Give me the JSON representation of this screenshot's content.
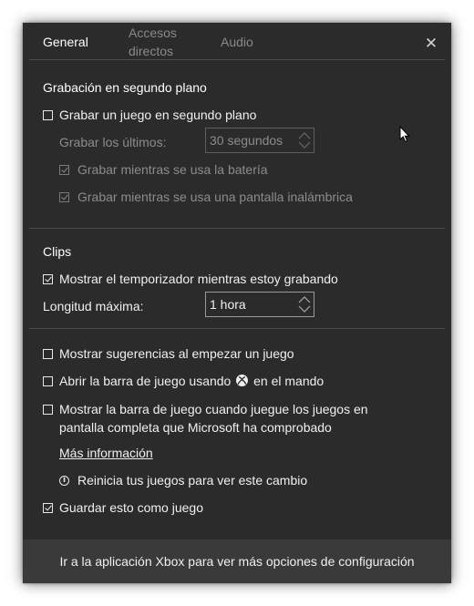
{
  "tabs": {
    "general": "General",
    "accesos_line1": "Accesos",
    "accesos_line2": "directos",
    "audio": "Audio"
  },
  "close_glyph": "✕",
  "background_recording": {
    "title": "Grabación en segundo plano",
    "record_game": {
      "label": "Grabar un juego en segundo plano",
      "checked": false
    },
    "record_last": {
      "label": "Grabar los últimos:",
      "value": "30 segundos"
    },
    "record_battery": {
      "label": "Grabar mientras se usa la batería",
      "checked": true
    },
    "record_wireless": {
      "label": "Grabar mientras se usa una pantalla inalámbrica",
      "checked": true
    }
  },
  "clips": {
    "title": "Clips",
    "show_timer": {
      "label": "Mostrar el temporizador mientras estoy grabando",
      "checked": true
    },
    "max_length": {
      "label": "Longitud máxima:",
      "value": "1 hora"
    }
  },
  "options": {
    "show_tips": {
      "label": "Mostrar sugerencias al empezar un juego",
      "checked": false
    },
    "open_bar_prefix": "Abrir la barra de juego usando",
    "open_bar_suffix": "en el mando",
    "open_bar_checked": false,
    "show_bar_line1": "Mostrar la barra de juego cuando juegue los juegos en",
    "show_bar_line2": "pantalla completa que Microsoft ha comprobado",
    "show_bar_checked": false,
    "more_info": "Más información",
    "restart_note": "Reinicia tus juegos para ver este cambio",
    "save_as_game": {
      "label": "Guardar esto como juego",
      "checked": true
    }
  },
  "footer": "Ir a la aplicación Xbox para ver más opciones de configuración",
  "icons": {
    "close": "close-icon",
    "info": "info-icon",
    "xbox": "xbox-icon",
    "cursor": "mouse-pointer-icon"
  },
  "colors": {
    "window_bg": "#2b2b2b",
    "footer_bg": "#3a3a3a",
    "text": "#f0f0f0",
    "disabled_text": "#8c8c8c"
  }
}
